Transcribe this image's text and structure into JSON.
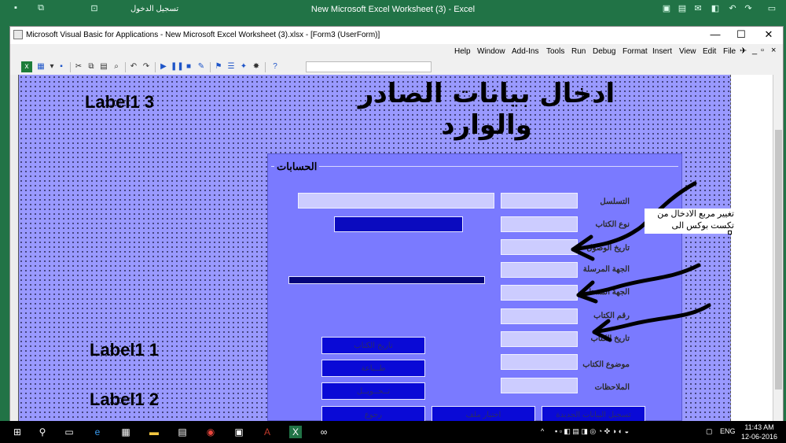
{
  "excel": {
    "title": "New Microsoft Excel Worksheet (3) - Excel",
    "signin": "تسجيل الدخول",
    "min": "—",
    "restore": "▭",
    "close": "✕"
  },
  "vbe": {
    "title": "Microsoft Visual Basic for Applications - New Microsoft Excel Worksheet (3).xlsx - [Form3 (UserForm)]",
    "min": "—",
    "max": "☐",
    "close": "✕",
    "menu": [
      "Help",
      "Window",
      "Add-Ins",
      "Tools",
      "Run",
      "Debug",
      "Format",
      "Insert",
      "View",
      "Edit",
      "File"
    ],
    "menu_ctl": [
      "_",
      "▫",
      "×"
    ]
  },
  "form": {
    "heading": "ادخال بيانات الصادر والوارد",
    "label3": "Label1 3",
    "label1": "Label1 1",
    "label2": "Label1 2",
    "frame_caption": "الحسابات",
    "fields": [
      "التسلسل",
      "نوع الكتاب",
      "تاريخ الوصول",
      "الجهة المرسلة",
      "الجهة المستلمة",
      "رقم الكتاب",
      "تاريخ الكتاب",
      "موضوع الكتاب",
      "الملاحظات"
    ],
    "buttons": {
      "btn_date": "تاريخ الكتاب",
      "btn_print": "طــباعة",
      "btn_transfer": "تــحــويــل",
      "btn_back": "رجوع",
      "btn_open": "اختيار ملف",
      "btn_save": "تسجيل البيانات الجديدة"
    }
  },
  "note": {
    "line1": "تغيير مربع الادخال من",
    "line2": "تكست بوكس الى"
  },
  "taskbar": {
    "lang": "ENG",
    "time": "11:43 AM",
    "date": "12-06-2016"
  }
}
